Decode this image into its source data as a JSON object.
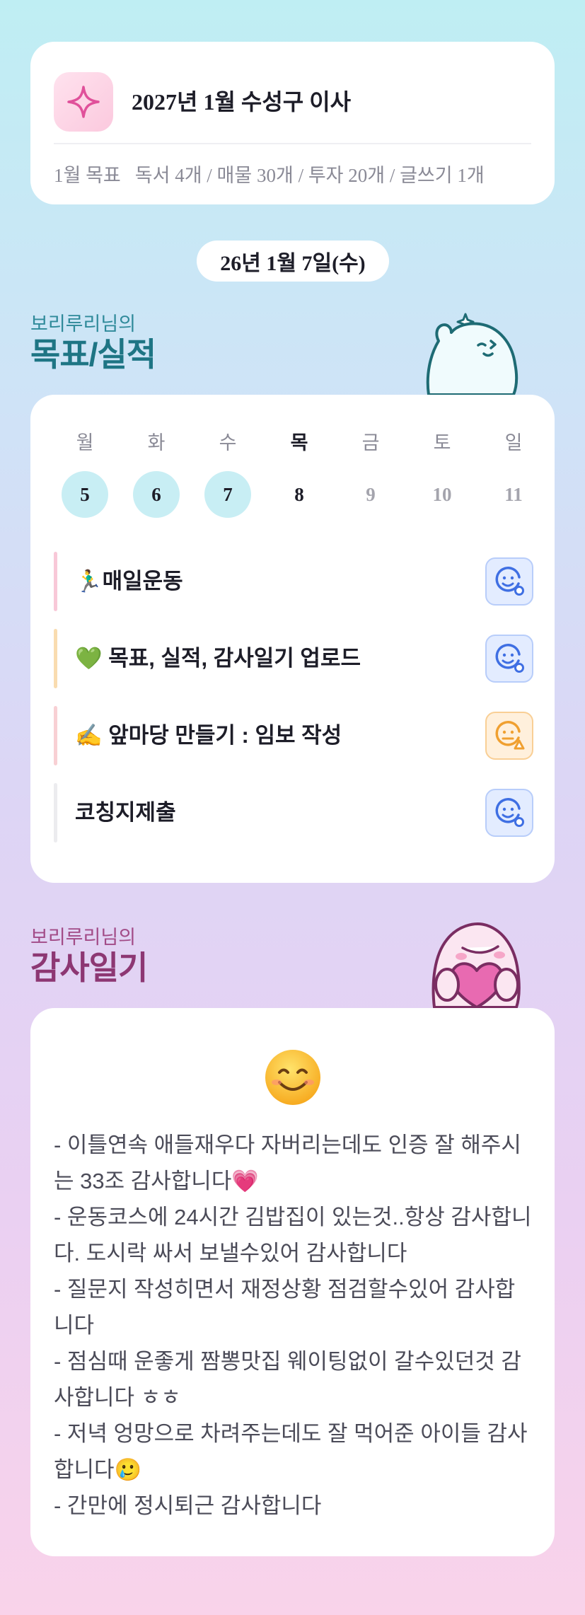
{
  "header": {
    "title": "2027년 1월 수성구 이사",
    "goals_label": "1월 목표",
    "goals_text": "독서 4개 / 매물 30개 / 투자 20개 / 글쓰기 1개"
  },
  "date": "26년 1월 7일(수)",
  "goals_section": {
    "subtitle": "보리루리님의",
    "title": "목표/실적"
  },
  "week": [
    {
      "name": "월",
      "num": "5",
      "state": "done"
    },
    {
      "name": "화",
      "num": "6",
      "state": "done"
    },
    {
      "name": "수",
      "num": "7",
      "state": "done"
    },
    {
      "name": "목",
      "num": "8",
      "state": "today"
    },
    {
      "name": "금",
      "num": "9",
      "state": "future"
    },
    {
      "name": "토",
      "num": "10",
      "state": "future"
    },
    {
      "name": "일",
      "num": "11",
      "state": "future"
    }
  ],
  "tasks": [
    {
      "label": "🏃‍♂️매일운동",
      "bar_color": "#f8c8d8",
      "status_icon": "smile-check-icon",
      "status_color": "#3f6fe3"
    },
    {
      "label": "💚 목표, 실적, 감사일기 업로드",
      "bar_color": "#f9dcb0",
      "status_icon": "smile-check-icon",
      "status_color": "#3f6fe3"
    },
    {
      "label": "✍️ 앞마당 만들기 : 임보 작성",
      "bar_color": "#f8d0d4",
      "status_icon": "smile-warning-icon",
      "status_color": "#f0a030"
    },
    {
      "label": "코칭지제출",
      "bar_color": "#ececef",
      "status_icon": "smile-check-icon",
      "status_color": "#3f6fe3"
    }
  ],
  "thanks_section": {
    "subtitle": "보리루리님의",
    "title": "감사일기",
    "mood_icon": "smiling-face-emoji",
    "lines": [
      "- 이틀연속 애들재우다 자버리는데도 인증 잘 해주시는 33조 감사합니다💗",
      "- 운동코스에 24시간 김밥집이 있는것..항상 감사합니다. 도시락 싸서 보낼수있어 감사합니다",
      "- 질문지 작성히면서 재정상황 점검할수있어 감사합니다",
      "- 점심때 운좋게 짬뽕맛집 웨이팅없이 갈수있던것 감사합니다 ㅎㅎ",
      "- 저녁 엉망으로 차려주는데도 잘 먹어준 아이들 감사합니다🥲",
      "- 간만에 정시퇴근 감사합니다"
    ]
  },
  "colors": {
    "accent_teal": "#1e7584",
    "accent_plum": "#8d3773",
    "done_day_bg": "#c8eef4"
  }
}
